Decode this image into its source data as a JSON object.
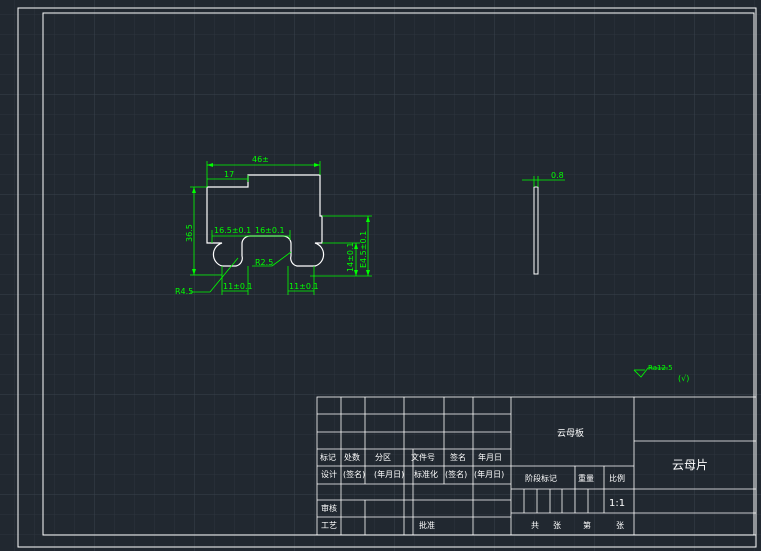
{
  "colors": {
    "background": "#212830",
    "grid": "#2c343c",
    "frame": "#ffffff",
    "dimension": "#00ff00",
    "surface_symbol": "#00ff00",
    "table_text": "#ffffff"
  },
  "drawing": {
    "dim_width_total": "46±",
    "dim_width_top": "17",
    "dim_height_total": "36.5",
    "dim_slot_left": "16.5±0.1",
    "dim_slot_right": "16±0.1",
    "dim_radius_small": "R2.5",
    "dim_radius_large": "R4.5",
    "dim_hole_left": "11±0.1",
    "dim_hole_right": "11±0.1",
    "dim_height_inner": "14±0.1",
    "dim_height_right": "E4.5±0.1",
    "dim_thickness": "0.8",
    "roughness_value": "Ra12.5",
    "roughness_general": "(√)"
  },
  "title_block": {
    "label_mark": "标记",
    "label_count": "处数",
    "label_zone": "分区",
    "label_doc_no": "文件号",
    "label_sign": "签名",
    "label_date": "年月日",
    "label_design": "设计",
    "label_sign_paren": "(签名)",
    "label_date_paren": "(年月日)",
    "label_standard": "标准化",
    "label_review": "审核",
    "label_process": "工艺",
    "label_approve": "批准",
    "material": "云母板",
    "stage_mark": "阶段标记",
    "weight": "重量",
    "scale_label": "比例",
    "scale_value": "1:1",
    "total_sheets": "共",
    "sheets_unit": "张",
    "sheet_no": "第",
    "sheet_unit": "张",
    "part_name": "云母片"
  }
}
